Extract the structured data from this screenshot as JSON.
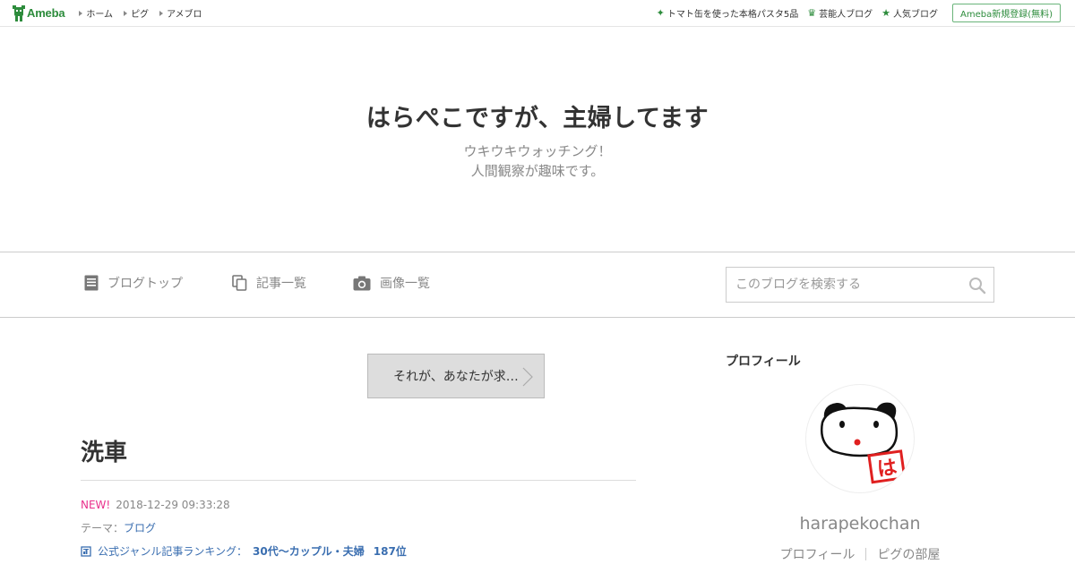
{
  "topbar": {
    "logo_text": "Ameba",
    "nav": [
      {
        "label": "ホーム"
      },
      {
        "label": "ピグ"
      },
      {
        "label": "アメブロ"
      }
    ],
    "right_links": [
      {
        "icon": "sparkle-icon",
        "label": "トマト缶を使った本格パスタ5品"
      },
      {
        "icon": "crown-icon",
        "label": "芸能人ブログ"
      },
      {
        "icon": "star-icon",
        "label": "人気ブログ"
      }
    ],
    "signup_label": "Ameba新規登録(無料)",
    "accent_color": "#2d8c3c"
  },
  "header": {
    "title": "はらぺこですが、主婦してます",
    "description_line1": "ウキウキウォッチング！",
    "description_line2": "人間観察が趣味です。"
  },
  "nav": {
    "items": [
      {
        "icon": "document-icon",
        "label": "ブログトップ"
      },
      {
        "icon": "copy-icon",
        "label": "記事一覧"
      },
      {
        "icon": "camera-icon",
        "label": "画像一覧"
      }
    ],
    "search_placeholder": "このブログを検索する"
  },
  "main": {
    "promo_label": "それが、あなたが求…",
    "entry": {
      "title": "洗車",
      "new_badge": "NEW!",
      "datetime": "2018-12-29 09:33:28",
      "theme_label": "テーマ：",
      "theme_value": "ブログ",
      "ranking_label": "公式ジャンル記事ランキング：",
      "ranking_genre": "30代〜カップル・夫婦",
      "ranking_rank": "187位"
    }
  },
  "sidebar": {
    "heading": "プロフィール",
    "username": "harapekochan",
    "links": [
      {
        "label": "プロフィール"
      },
      {
        "label": "ピグの部屋"
      }
    ],
    "avatar_stamp_text": "は"
  }
}
